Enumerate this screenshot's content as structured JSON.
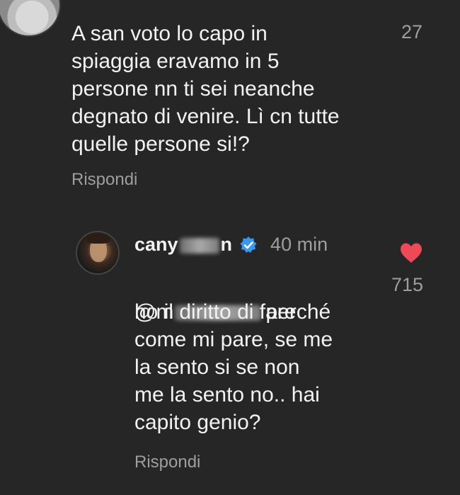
{
  "top_comment": {
    "text": "A san voto lo capo in\nspiaggia eravamo in 5\npersone nn ti sei neanche\ndegnato di venire. Lì cn tutte\nquelle persone si!?",
    "like_count": "27",
    "reply_label": "Rispondi"
  },
  "reply_comment": {
    "username": "cany",
    "username_suffix": "n",
    "time": "40 min",
    "mention_prefix": "@m",
    "text_line1_end": "perché",
    "text_rest": "ho il diritto di fare\ncome mi pare, se me\nla sento si se non\nme la sento no.. hai\ncapito genio?",
    "like_count": "715",
    "reply_label": "Rispondi"
  },
  "colors": {
    "background": "#262626",
    "text": "#f2f2f2",
    "muted": "#9e9e9e",
    "heart_red": "#ed4956",
    "verified_blue": "#3897f0"
  }
}
